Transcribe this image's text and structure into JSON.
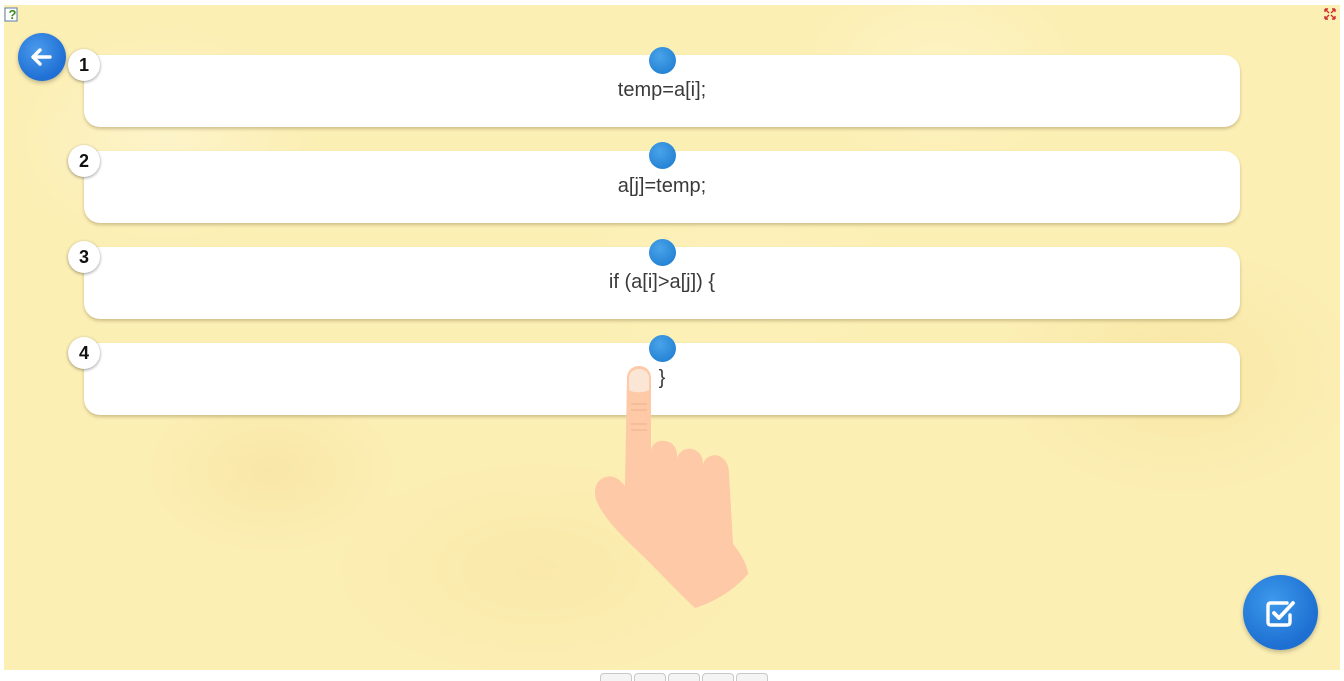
{
  "icons": {
    "help": "help-icon",
    "fullscreen": "fullscreen-icon",
    "back": "back-arrow-icon",
    "check": "checkbox-check-icon",
    "drag_handle": "drag-handle-icon",
    "hand": "pointing-hand-icon"
  },
  "colors": {
    "background": "#fcefb4",
    "accent": "#2583d4",
    "card": "#ffffff",
    "hand": "#fdc9a6"
  },
  "rows": [
    {
      "number": "1",
      "code": "temp=a[i];"
    },
    {
      "number": "2",
      "code": "a[j]=temp;"
    },
    {
      "number": "3",
      "code": "if (a[i]>a[j]) {"
    },
    {
      "number": "4",
      "code": "}"
    }
  ],
  "pager": {
    "page_count": 5
  }
}
